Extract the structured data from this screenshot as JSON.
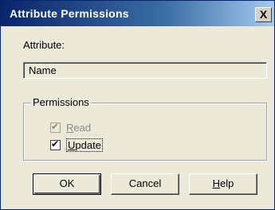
{
  "window": {
    "title": "Attribute Permissions",
    "close_glyph": "X"
  },
  "attribute": {
    "label": "Attribute:",
    "value": "Name"
  },
  "permissions": {
    "group_label": "Permissions",
    "options": [
      {
        "label": "Read",
        "accel": "R",
        "rest": "ead",
        "checked": true,
        "enabled": false
      },
      {
        "label": "Update",
        "accel": "U",
        "rest": "pdate",
        "checked": true,
        "enabled": true
      }
    ]
  },
  "buttons": {
    "ok": "OK",
    "cancel": "Cancel",
    "help_accel": "H",
    "help_rest": "elp"
  },
  "icons": {
    "check": "check-icon",
    "close": "close-icon"
  }
}
